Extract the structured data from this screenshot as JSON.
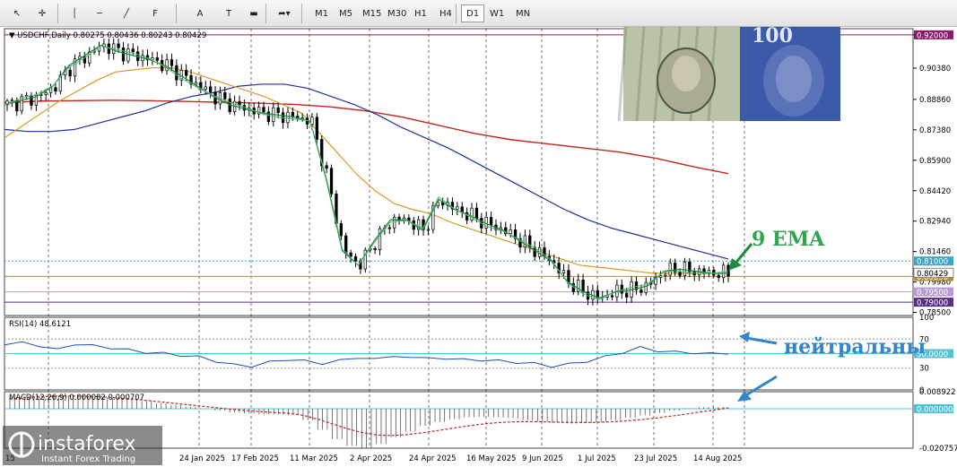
{
  "toolbar": {
    "tools": [
      "cursor-icon",
      "crosshair-icon",
      "vertical-line-icon",
      "horizontal-line-icon",
      "trendline-icon",
      "fibonacci-icon",
      "text-icon",
      "text-label-icon",
      "rectangle-icon",
      "arrows-icon"
    ],
    "text_tool": "A",
    "timeframes": [
      "M1",
      "M5",
      "M15",
      "M30",
      "H1",
      "H4",
      "D1",
      "W1",
      "MN"
    ],
    "active_timeframe": "D1"
  },
  "chart_data": [
    {
      "type": "line",
      "panel": "price",
      "title": "USDCHF,Daily  0.80275 0.80436 0.80243 0.80429",
      "ylim": [
        0.7835,
        0.923
      ],
      "y_ticks": [
        "0.92000",
        "0.90380",
        "0.88860",
        "0.87380",
        "0.85900",
        "0.84420",
        "0.82940",
        "0.81460",
        "0.79980",
        "0.78500"
      ],
      "x_ticks": [
        "24 Jan 2025",
        "17 Feb 2025",
        "11 Mar 2025",
        "2 Apr 2025",
        "24 Apr 2025",
        "16 May 2025",
        "9 Jun 2025",
        "1 Jul 2025",
        "23 Jul 2025",
        "14 Aug 2025"
      ],
      "x_tick_partial": "15 ",
      "levels": [
        {
          "value": 0.92,
          "label": "0.92000",
          "color": "#8b1a6b"
        },
        {
          "value": 0.81,
          "label": "0.81000",
          "color": "#3aa6c8"
        },
        {
          "value": 0.8025,
          "label": "0.80250",
          "color": "#b38a3a"
        },
        {
          "value": 0.795,
          "label": "0.79500",
          "color": "#b99bd8"
        },
        {
          "value": 0.79,
          "label": "0.79000",
          "color": "#5a2d8a"
        }
      ],
      "current_price_label": "0.80429",
      "series": [
        {
          "name": "",
          "color": "#1e8c3e",
          "values": [
            0.886,
            0.888,
            0.89,
            0.895,
            0.905,
            0.91,
            0.915,
            0.912,
            0.91,
            0.908,
            0.905,
            0.9,
            0.895,
            0.89,
            0.886,
            0.884,
            0.882,
            0.881,
            0.88,
            0.878,
            0.85,
            0.815,
            0.808,
            0.82,
            0.83,
            0.83,
            0.825,
            0.84,
            0.835,
            0.832,
            0.828,
            0.825,
            0.82,
            0.815,
            0.81,
            0.8,
            0.795,
            0.792,
            0.795,
            0.796,
            0.798,
            0.805,
            0.806,
            0.805,
            0.804,
            0.804
          ]
        },
        {
          "name": "",
          "color": "#d79b2a",
          "values": [
            0.87,
            0.876,
            0.882,
            0.888,
            0.893,
            0.898,
            0.902,
            0.903,
            0.904,
            0.904,
            0.902,
            0.899,
            0.896,
            0.893,
            0.89,
            0.886,
            0.882,
            0.872,
            0.862,
            0.852,
            0.844,
            0.838,
            0.835,
            0.833,
            0.829,
            0.826,
            0.823,
            0.82,
            0.817,
            0.814,
            0.811,
            0.808,
            0.807,
            0.806,
            0.805,
            0.804,
            0.804,
            0.804,
            0.804,
            0.804
          ]
        },
        {
          "name": "",
          "color": "#1f2f9c",
          "values": [
            0.874,
            0.873,
            0.873,
            0.874,
            0.877,
            0.88,
            0.883,
            0.887,
            0.89,
            0.892,
            0.895,
            0.896,
            0.896,
            0.894,
            0.89,
            0.886,
            0.881,
            0.875,
            0.87,
            0.865,
            0.859,
            0.853,
            0.847,
            0.841,
            0.835,
            0.83,
            0.826,
            0.823,
            0.82,
            0.817,
            0.814,
            0.811
          ]
        },
        {
          "name": "",
          "color": "#c0281e",
          "values": [
            0.887,
            0.8878,
            0.888,
            0.8882,
            0.888,
            0.8876,
            0.8872,
            0.8868,
            0.8862,
            0.885,
            0.883,
            0.88,
            0.876,
            0.872,
            0.869,
            0.867,
            0.865,
            0.863,
            0.86,
            0.856,
            0.8525
          ]
        }
      ],
      "annotation": "9 EMA"
    },
    {
      "type": "line",
      "panel": "rsi",
      "title": "RSI(14) 48.6121",
      "ylim": [
        0,
        100
      ],
      "y_ticks": [
        "100",
        "70",
        "30",
        "0"
      ],
      "level_label": "50.0000",
      "values": [
        62,
        66,
        60,
        56,
        63,
        61,
        58,
        55,
        52,
        50,
        48,
        45,
        40,
        34,
        33,
        38,
        42,
        40,
        36,
        41,
        44,
        43,
        46,
        45,
        44,
        43,
        42,
        41,
        40,
        38,
        36,
        33,
        35,
        40,
        45,
        52,
        58,
        54,
        52,
        51,
        50,
        50
      ],
      "annotation": "нейтральны"
    },
    {
      "type": "bar",
      "panel": "macd",
      "title": "MACD(12,26,9) 0.000082 0.000707",
      "ylim": [
        -0.020757,
        0.008922
      ],
      "y_ticks": [
        "0.008922",
        "-0.020757"
      ],
      "zero_label": "0.000000",
      "values": [
        0.006,
        0.0065,
        0.0068,
        0.007,
        0.0068,
        0.0064,
        0.006,
        0.0055,
        0.0048,
        0.004,
        0.003,
        0.002,
        0.001,
        0.0,
        -0.001,
        -0.002,
        -0.0025,
        -0.003,
        -0.003,
        -0.0032,
        -0.006,
        -0.011,
        -0.016,
        -0.0195,
        -0.0205,
        -0.0185,
        -0.015,
        -0.012,
        -0.009,
        -0.007,
        -0.0055,
        -0.0045,
        -0.0042,
        -0.0045,
        -0.005,
        -0.006,
        -0.0068,
        -0.0074,
        -0.0078,
        -0.0076,
        -0.007,
        -0.006,
        -0.0048,
        -0.0035,
        -0.0022,
        -0.001,
        0.0002,
        0.0008,
        0.001,
        0.0006
      ],
      "signal": [
        0.005,
        0.0058,
        0.0063,
        0.0066,
        0.0067,
        0.0066,
        0.0063,
        0.0059,
        0.0053,
        0.0046,
        0.0038,
        0.003,
        0.0022,
        0.0014,
        0.0006,
        -0.0002,
        -0.0009,
        -0.0015,
        -0.002,
        -0.0024,
        -0.0035,
        -0.0055,
        -0.008,
        -0.0105,
        -0.0125,
        -0.0138,
        -0.0141,
        -0.0137,
        -0.0128,
        -0.0117,
        -0.0105,
        -0.0093,
        -0.0083,
        -0.0075,
        -0.007,
        -0.0068,
        -0.0068,
        -0.007,
        -0.0072,
        -0.0073,
        -0.0072,
        -0.0069,
        -0.0064,
        -0.0058,
        -0.005,
        -0.004,
        -0.003,
        -0.0018,
        -0.0008,
        0.0004
      ]
    }
  ],
  "photo_tiles": [
    "usd-banknote",
    "chf-banknote"
  ],
  "photo_text": {
    "chf_denomination": "100"
  },
  "watermark": {
    "brand": "instaforex",
    "tagline": "Instant Forex Trading"
  }
}
